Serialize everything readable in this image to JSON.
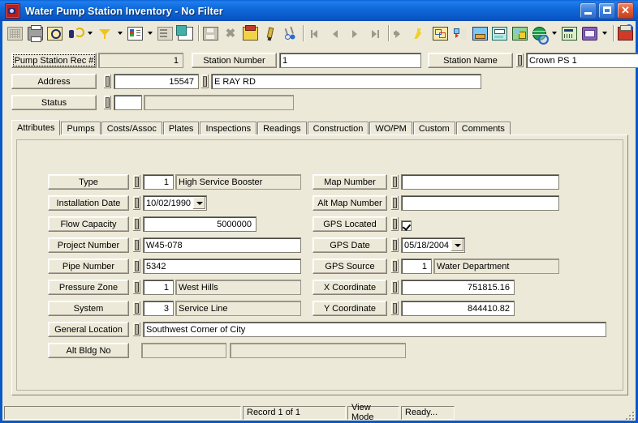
{
  "window": {
    "title": "Water Pump Station Inventory - No Filter",
    "app_icon": "camera-icon",
    "minimize_label": "_",
    "maximize_label": "",
    "close_label": "✕"
  },
  "toolbar": {
    "buttons": [
      {
        "name": "grid-view-button",
        "icon": "i-grid",
        "title": "Grid View",
        "enabled": false
      },
      {
        "name": "print-button",
        "icon": "i-print",
        "title": "Print",
        "enabled": true
      },
      {
        "name": "print-preview-button",
        "icon": "i-preview",
        "title": "Print Preview",
        "enabled": true
      },
      {
        "name": "find-button",
        "icon": "i-find",
        "title": "Find",
        "enabled": true,
        "dropdown": true
      },
      {
        "name": "filter-button",
        "icon": "i-filter",
        "title": "Filter",
        "enabled": true,
        "dropdown": true
      },
      {
        "name": "report-button",
        "icon": "i-report",
        "title": "Reports",
        "enabled": true,
        "dropdown": true
      },
      {
        "name": "form-button",
        "icon": "i-form",
        "title": "Form",
        "enabled": false
      },
      {
        "name": "copy-record-button",
        "icon": "i-copy",
        "title": "Copy Record",
        "enabled": true
      },
      {
        "sep": true
      },
      {
        "name": "save-button",
        "icon": "i-save",
        "title": "Save",
        "enabled": false
      },
      {
        "name": "delete-button",
        "icon": "i-del",
        "title": "Delete",
        "enabled": false,
        "glyph": "✖"
      },
      {
        "name": "post-button",
        "icon": "i-stack",
        "title": "Post",
        "enabled": true
      },
      {
        "name": "edit-button",
        "icon": "i-pencil",
        "title": "Edit",
        "enabled": true
      },
      {
        "name": "cut-button",
        "icon": "i-scissor",
        "title": "Cut",
        "enabled": true
      },
      {
        "sep": true
      },
      {
        "name": "first-record-button",
        "icon": "nav-first",
        "title": "First Record",
        "enabled": false
      },
      {
        "name": "previous-record-button",
        "icon": "nav-prev",
        "title": "Previous Record",
        "enabled": false
      },
      {
        "name": "next-record-button",
        "icon": "nav-next",
        "title": "Next Record",
        "enabled": false
      },
      {
        "name": "last-record-button",
        "icon": "nav-last",
        "title": "Last Record",
        "enabled": false
      },
      {
        "sep": true
      },
      {
        "name": "goto-button",
        "icon": "nav-go",
        "title": "Go To",
        "enabled": false
      },
      {
        "name": "quick-action-button",
        "icon": "i-bolt",
        "title": "Quick Action",
        "enabled": true
      },
      {
        "name": "map-button",
        "icon": "i-map",
        "title": "Map",
        "enabled": true
      },
      {
        "name": "hierarchy-button",
        "icon": "i-tree",
        "title": "Hierarchy",
        "enabled": true
      },
      {
        "name": "monitor-button",
        "icon": "i-monitor",
        "title": "Monitor",
        "enabled": true
      },
      {
        "name": "fax-button",
        "icon": "i-fax",
        "title": "Fax",
        "enabled": true
      },
      {
        "name": "image-button",
        "icon": "i-photo",
        "title": "Images",
        "enabled": true
      },
      {
        "name": "gis-button",
        "icon": "i-globe",
        "title": "GIS",
        "enabled": true,
        "dropdown": true
      },
      {
        "name": "calculator-button",
        "icon": "i-calc",
        "title": "Calculator",
        "enabled": true
      },
      {
        "name": "help-book-button",
        "icon": "i-book",
        "title": "Help",
        "enabled": true,
        "dropdown": true
      },
      {
        "sep": true
      },
      {
        "name": "exit-button",
        "icon": "i-exit",
        "title": "Exit",
        "enabled": true
      }
    ]
  },
  "header": {
    "rec_label": "Pump Station Rec #",
    "rec_value": "1",
    "station_number_label": "Station Number",
    "station_number_value": "1",
    "station_name_label": "Station Name",
    "station_name_value": "Crown PS 1",
    "address_label": "Address",
    "address_number_value": "15547",
    "address_street_value": "E RAY RD",
    "status_label": "Status",
    "status_code_value": "",
    "status_desc_value": ""
  },
  "tabs": [
    {
      "label": "Attributes",
      "active": true
    },
    {
      "label": "Pumps",
      "active": false
    },
    {
      "label": "Costs/Assoc",
      "active": false
    },
    {
      "label": "Plates",
      "active": false
    },
    {
      "label": "Inspections",
      "active": false
    },
    {
      "label": "Readings",
      "active": false
    },
    {
      "label": "Construction",
      "active": false
    },
    {
      "label": "WO/PM",
      "active": false
    },
    {
      "label": "Custom",
      "active": false
    },
    {
      "label": "Comments",
      "active": false
    }
  ],
  "attributes": {
    "left_fields": [
      {
        "label": "Type",
        "code": "1",
        "value": "High Service Booster",
        "kind": "code_desc"
      },
      {
        "label": "Installation Date",
        "value": "10/02/1990",
        "kind": "date"
      },
      {
        "label": "Flow Capacity",
        "value": "5000000",
        "kind": "number"
      },
      {
        "label": "Project Number",
        "value": "W45-078",
        "kind": "text"
      },
      {
        "label": "Pipe Number",
        "value": "5342",
        "kind": "text"
      },
      {
        "label": "Pressure Zone",
        "code": "1",
        "value": "West Hills",
        "kind": "code_desc"
      },
      {
        "label": "System",
        "code": "3",
        "value": "Service Line",
        "kind": "code_desc"
      }
    ],
    "right_fields": [
      {
        "label": "Map Number",
        "value": "",
        "kind": "text"
      },
      {
        "label": "Alt Map Number",
        "value": "",
        "kind": "text"
      },
      {
        "label": "GPS Located",
        "value": "",
        "kind": "checkbox",
        "checked": true
      },
      {
        "label": "GPS Date",
        "value": "05/18/2004",
        "kind": "date"
      },
      {
        "label": "GPS Source",
        "code": "1",
        "value": "Water Department",
        "kind": "code_desc"
      },
      {
        "label": "X Coordinate",
        "value": "751815.16",
        "kind": "number"
      },
      {
        "label": "Y Coordinate",
        "value": "844410.82",
        "kind": "number"
      }
    ],
    "general_location": {
      "label": "General Location",
      "value": "Southwest Corner of City"
    },
    "alt_bldg_no": {
      "label": "Alt Bldg No",
      "value": "",
      "value2": ""
    }
  },
  "statusbar": {
    "record": "Record 1 of 1",
    "mode": "View Mode",
    "state": "Ready..."
  },
  "colors": {
    "titlebar_blue": "#0a59c8",
    "face": "#ece9d8",
    "field_white": "#ffffff",
    "border_shadow": "#868076"
  }
}
